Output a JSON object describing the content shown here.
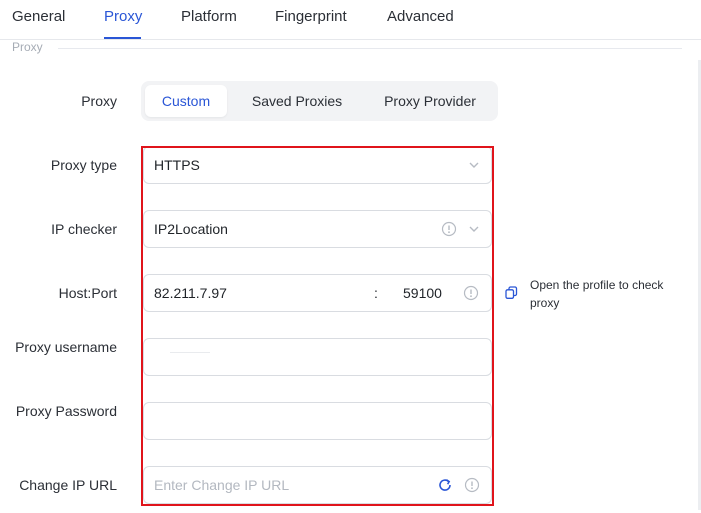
{
  "tabs": [
    "General",
    "Proxy",
    "Platform",
    "Fingerprint",
    "Advanced"
  ],
  "active_tab": "Proxy",
  "section": {
    "label": "Proxy"
  },
  "proxy_mode": {
    "label": "Proxy",
    "options": [
      "Custom",
      "Saved Proxies",
      "Proxy Provider"
    ],
    "selected": "Custom"
  },
  "proxy_type": {
    "label": "Proxy type",
    "value": "HTTPS"
  },
  "ip_checker": {
    "label": "IP checker",
    "value": "IP2Location"
  },
  "host_port": {
    "label": "Host:Port",
    "host": "82.211.7.97",
    "separator": ":",
    "port": "59100",
    "hint": "Open the profile to check proxy"
  },
  "proxy_username": {
    "label": "Proxy username",
    "value": ""
  },
  "proxy_password": {
    "label": "Proxy Password",
    "value": ""
  },
  "change_ip_url": {
    "label": "Change IP URL",
    "placeholder": "Enter Change IP URL",
    "value": ""
  },
  "colors": {
    "accent": "#2a56d6",
    "highlight": "#e0141b",
    "border": "#d9dce1",
    "muted": "#b3b8c0"
  },
  "icons": [
    "chevron-down-icon",
    "info-circle-icon",
    "copy-icon",
    "refresh-icon"
  ]
}
